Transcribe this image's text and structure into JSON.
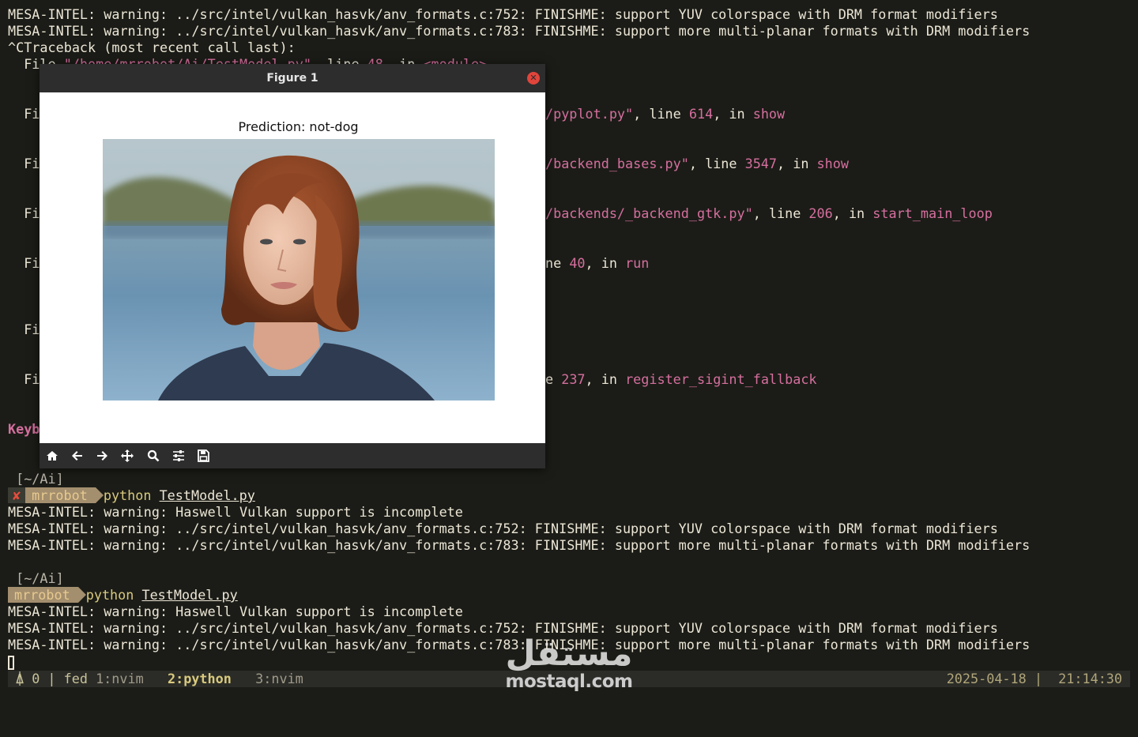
{
  "terminal": {
    "top_lines": [
      "MESA-INTEL: warning: ../src/intel/vulkan_hasvk/anv_formats.c:752: FINISHME: support YUV colorspace with DRM format modifiers",
      "MESA-INTEL: warning: ../src/intel/vulkan_hasvk/anv_formats.c:783: FINISHME: support more multi-planar formats with DRM modifiers",
      "^CTraceback (most recent call last):"
    ],
    "file_partial": "  File ",
    "file_path_partial": "\"/home/mrrobot/Ai/TestModel.py\"",
    "file_mid_partial": ", line ",
    "file_num_partial": "48",
    "file_in_partial": ", in ",
    "file_module_partial": "<module>",
    "fi": "  Fi",
    "traces": [
      {
        "path": "/pyplot.py\"",
        "line": "614",
        "func": "show"
      },
      {
        "path": "/backend_bases.py\"",
        "line": "3547",
        "func": "show"
      },
      {
        "path": "/backends/_backend_gtk.py\"",
        "line": "206",
        "func": "start_main_loop"
      },
      {
        "path": "ne ",
        "line": "40",
        "func": "run"
      },
      {
        "path": "e ",
        "line": "237",
        "func": "register_sigint_fallback"
      }
    ],
    "keyb": "Keyb",
    "session1": {
      "dir": " [~/Ai]",
      "status_icon": "✘",
      "user": "mrrobot",
      "cmd": "python",
      "arg": "TestModel.py",
      "out": [
        "MESA-INTEL: warning: Haswell Vulkan support is incomplete",
        "MESA-INTEL: warning: ../src/intel/vulkan_hasvk/anv_formats.c:752: FINISHME: support YUV colorspace with DRM format modifiers",
        "MESA-INTEL: warning: ../src/intel/vulkan_hasvk/anv_formats.c:783: FINISHME: support more multi-planar formats with DRM modifiers"
      ]
    },
    "session2": {
      "dir": " [~/Ai]",
      "user": "mrrobot",
      "cmd": "python",
      "arg": "TestModel.py",
      "out": [
        "MESA-INTEL: warning: Haswell Vulkan support is incomplete",
        "MESA-INTEL: warning: ../src/intel/vulkan_hasvk/anv_formats.c:752: FINISHME: support YUV colorspace with DRM format modifiers",
        "MESA-INTEL: warning: ../src/intel/vulkan_hasvk/anv_formats.c:783: FINISHME: support more multi-planar formats with DRM modifiers"
      ]
    }
  },
  "statusbar": {
    "bell": "🔔 0 |",
    "bell_text": "⍋ 0 |",
    "session": "fed",
    "win1": "1:nvim",
    "win2": "2:python",
    "win3": "3:nvim",
    "date": "2025-04-18 |",
    "time": "21:14:30"
  },
  "figure": {
    "window_title": "Figure 1",
    "plot_title": "Prediction: not-dog",
    "toolbar_icons": [
      "home-icon",
      "back-icon",
      "forward-icon",
      "pan-icon",
      "zoom-icon",
      "configure-subplots-icon",
      "save-icon"
    ]
  },
  "watermark": {
    "arabic": "مستقل",
    "latin": "mostaql.com"
  },
  "colors": {
    "background": "#1b1c17",
    "text": "#ece6d6",
    "pink": "#d56f9e",
    "prompt_segment": "#a38e6e",
    "error_red": "#e74c3c"
  }
}
